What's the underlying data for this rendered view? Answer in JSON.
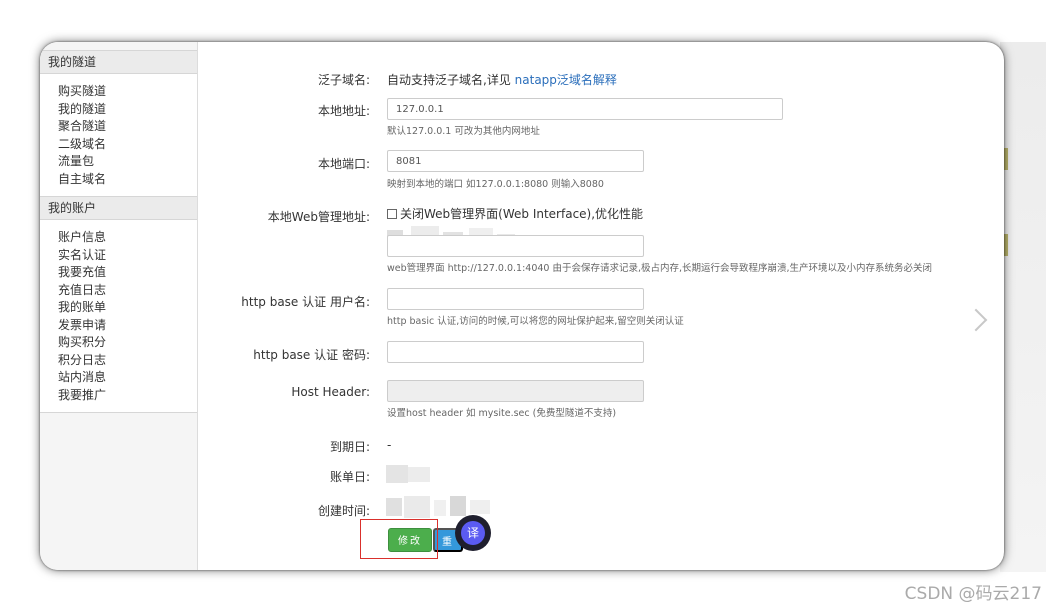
{
  "sidebar": {
    "sections": [
      {
        "title": "我的隧道",
        "items": [
          "购买隧道",
          "我的隧道",
          "聚合隧道",
          "二级域名",
          "流量包",
          "自主域名"
        ]
      },
      {
        "title": "我的账户",
        "items": [
          "账户信息",
          "实名认证",
          "我要充值",
          "充值日志",
          "我的账单",
          "发票申请",
          "购买积分",
          "积分日志",
          "站内消息",
          "我要推广"
        ]
      }
    ]
  },
  "form": {
    "wildcard": {
      "label": "泛子域名:",
      "text": "自动支持泛子域名,详见",
      "link": "natapp泛域名解释"
    },
    "local_addr": {
      "label": "本地地址:",
      "value": "127.0.0.1",
      "hint": "默认127.0.0.1 可改为其他内网地址"
    },
    "local_port": {
      "label": "本地端口:",
      "value": "8081",
      "hint": "映射到本地的端口 如127.0.0.1:8080 则输入8080"
    },
    "web_admin": {
      "label": "本地Web管理地址:",
      "checkbox": "关闭Web管理界面(Web Interface),优化性能",
      "hint": "web管理界面 http://127.0.0.1:4040 由于会保存请求记录,极占内存,长期运行会导致程序崩溃,生产环境以及小内存系统务必关闭"
    },
    "basic_user": {
      "label": "http base 认证 用户名:",
      "hint": "http basic 认证,访问的时候,可以将您的网址保护起来,留空则关闭认证"
    },
    "basic_pass": {
      "label": "http base 认证 密码:"
    },
    "host_header": {
      "label": "Host Header:",
      "hint": "设置host header 如 mysite.sec (免费型隧道不支持)"
    },
    "expire": {
      "label": "到期日:",
      "value": "-"
    },
    "bill_day": {
      "label": "账单日:"
    },
    "created": {
      "label": "创建时间:"
    },
    "buttons": {
      "modify": "修改",
      "reset": "重置"
    }
  },
  "translate_icon": "译",
  "watermark": "CSDN @码云217"
}
